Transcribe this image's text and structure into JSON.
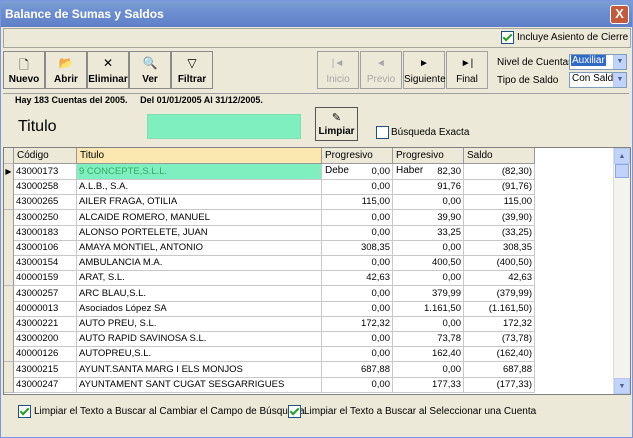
{
  "window": {
    "title": "Balance de Sumas y Saldos",
    "close": "X"
  },
  "options": {
    "include_cierre": "Incluye Asiento de Cierre"
  },
  "toolbar": {
    "nuevo": "Nuevo",
    "abrir": "Abrir",
    "eliminar": "Eliminar",
    "ver": "Ver",
    "filtrar": "Filtrar",
    "inicio": "Inicio",
    "previo": "Previo",
    "siguiente": "Siguiente",
    "final": "Final"
  },
  "right_panel": {
    "nivel_label": "Nivel de Cuentas",
    "nivel_value": "Auxiliar",
    "tipo_label": "Tipo de Saldo",
    "tipo_value": "Con Saldo"
  },
  "info": {
    "count": "Hay 183  Cuentas del 2005.",
    "range": "Del 01/01/2005 Al 31/12/2005."
  },
  "search": {
    "label": "Titulo",
    "value": "",
    "clear": "Limpiar",
    "exact": "Búsqueda Exacta"
  },
  "grid": {
    "columns": [
      "Código",
      "Titulo",
      "Progresivo Debe",
      "Progresivo Haber",
      "Saldo"
    ],
    "rows": [
      [
        "43000173",
        "9 CONCEPTE,S.L.L.",
        "0,00",
        "82,30",
        "(82,30)"
      ],
      [
        "43000258",
        "A.L.B., S.A.",
        "0,00",
        "91,76",
        "(91,76)"
      ],
      [
        "43000265",
        "AILER FRAGA, OTILIA",
        "115,00",
        "0,00",
        "115,00"
      ],
      [
        "43000250",
        "ALCAIDE ROMERO, MANUEL",
        "0,00",
        "39,90",
        "(39,90)"
      ],
      [
        "43000183",
        "ALONSO PORTELETE, JUAN",
        "0,00",
        "33,25",
        "(33,25)"
      ],
      [
        "43000106",
        "AMAYA MONTIEL, ANTONIO",
        "308,35",
        "0,00",
        "308,35"
      ],
      [
        "43000154",
        "AMBULANCIA M.A.",
        "0,00",
        "400,50",
        "(400,50)"
      ],
      [
        "40000159",
        "ARAT, S.L.",
        "42,63",
        "0,00",
        "42,63"
      ],
      [
        "43000257",
        "ARC BLAU,S.L.",
        "0,00",
        "379,99",
        "(379,99)"
      ],
      [
        "40000013",
        "Asociados López SA",
        "0,00",
        "1.161,50",
        "(1.161,50)"
      ],
      [
        "43000221",
        "AUTO PREU, S.L.",
        "172,32",
        "0,00",
        "172,32"
      ],
      [
        "43000200",
        "AUTO RAPID SAVINOSA S.L.",
        "0,00",
        "73,78",
        "(73,78)"
      ],
      [
        "40000126",
        "AUTOPREU,S.L.",
        "0,00",
        "162,40",
        "(162,40)"
      ],
      [
        "43000215",
        "AYUNT.SANTA MARG I ELS MONJOS",
        "687,88",
        "0,00",
        "687,88"
      ],
      [
        "43000247",
        "AYUNTAMENT SANT CUGAT SESGARRIGUES",
        "0,00",
        "177,33",
        "(177,33)"
      ]
    ]
  },
  "footer": {
    "opt1": "Limpiar el Texto a Buscar al Cambiar el Campo de Búsqueda",
    "opt2": "Limpiar el Texto a Buscar al Seleccionar una Cuenta"
  }
}
